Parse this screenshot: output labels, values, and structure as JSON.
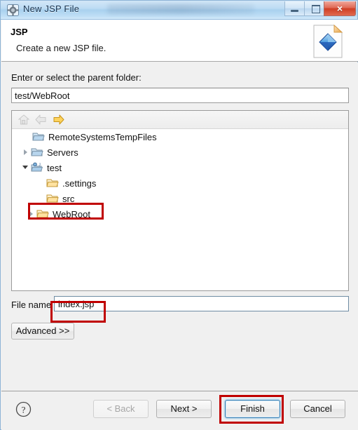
{
  "window": {
    "title": "New JSP File",
    "icon": "app-icon",
    "controls": {
      "minimize": "minimize-icon",
      "maximize": "maximize-icon",
      "close": "×"
    }
  },
  "header": {
    "title": "JSP",
    "subtitle": "Create a new JSP file.",
    "icon": "jsp-wizard-icon"
  },
  "main": {
    "parent_folder_label": "Enter or select the parent folder:",
    "parent_folder_value": "test/WebRoot",
    "tree_toolbar": [
      {
        "name": "home-icon",
        "enabled": false
      },
      {
        "name": "back-arrow-icon",
        "enabled": false
      },
      {
        "name": "forward-arrow-icon",
        "enabled": true
      }
    ],
    "tree": [
      {
        "label": "RemoteSystemsTempFiles",
        "indent": 1,
        "twisty": "none",
        "icon": "blue-folder-icon"
      },
      {
        "label": "Servers",
        "indent": 0,
        "twisty": "closed",
        "icon": "blue-folder-icon"
      },
      {
        "label": "test",
        "indent": 0,
        "twisty": "open",
        "icon": "java-project-icon"
      },
      {
        "label": ".settings",
        "indent": 2,
        "twisty": "none",
        "icon": "yellow-folder-icon"
      },
      {
        "label": "src",
        "indent": 2,
        "twisty": "none",
        "icon": "yellow-folder-icon"
      },
      {
        "label": "WebRoot",
        "indent": 1,
        "twisty": "closed",
        "icon": "yellow-folder-icon"
      }
    ],
    "file_name_label": "File name",
    "file_name_value": "index.jsp",
    "advanced_label": "Advanced >>"
  },
  "footer": {
    "help": "?",
    "back_label": "< Back",
    "next_label": "Next >",
    "finish_label": "Finish",
    "cancel_label": "Cancel"
  },
  "annotations": {
    "accent_color": "#c00000",
    "boxes": [
      "webroot-tree-item",
      "file-name-field",
      "finish-button"
    ]
  }
}
